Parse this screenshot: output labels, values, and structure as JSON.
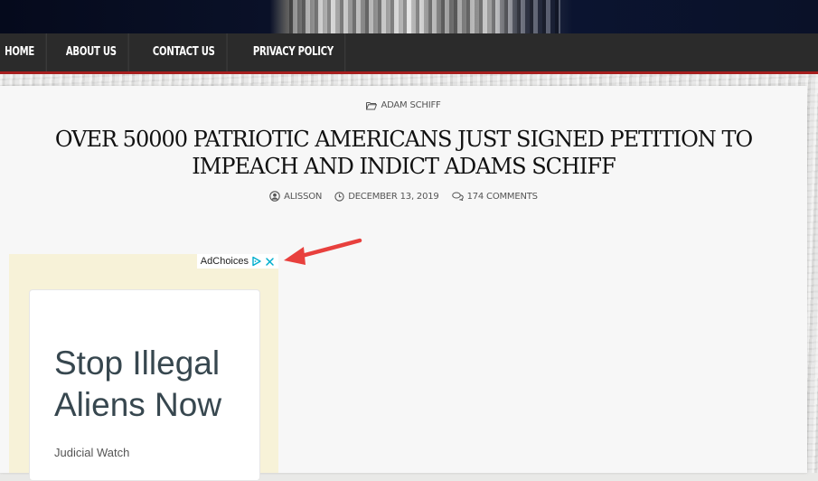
{
  "nav": {
    "items": [
      {
        "label": "HOME"
      },
      {
        "label": "ABOUT US"
      },
      {
        "label": "CONTACT US"
      },
      {
        "label": "PRIVACY POLICY"
      }
    ]
  },
  "post": {
    "category": "ADAM SCHIFF",
    "title": "OVER 50000 PATRIOTIC AMERICANS JUST SIGNED PETITION TO IMPEACH AND INDICT ADAMS SCHIFF",
    "author": "ALISSON",
    "date": "DECEMBER 13, 2019",
    "comments": "174 COMMENTS"
  },
  "ad": {
    "adchoices_label": "AdChoices",
    "headline": "Stop Illegal Aliens Now",
    "source": "Judicial Watch"
  },
  "icons": {
    "category": "folder-open-icon",
    "author": "user-circle-icon",
    "date": "clock-icon",
    "comments": "comments-icon",
    "adchoices": "adchoices-icon",
    "close": "close-icon"
  },
  "colors": {
    "nav_bg": "#2b2b2b",
    "nav_border": "#a51e1e",
    "ad_bg": "#f7f2d8",
    "ad_headline": "#37474f",
    "arrow": "#e8403d",
    "adchoices_blue": "#00aecd"
  }
}
